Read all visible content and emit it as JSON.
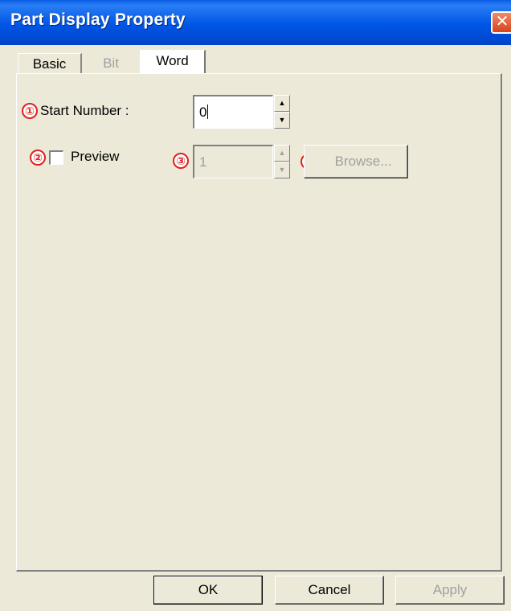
{
  "window": {
    "title": "Part Display Property",
    "close_icon": "close-icon"
  },
  "tabs": [
    {
      "label": "Basic",
      "state": "inactive"
    },
    {
      "label": "Bit",
      "state": "disabled"
    },
    {
      "label": "Word",
      "state": "active"
    }
  ],
  "start_number": {
    "marker": "①",
    "label": "Start Number :",
    "value": "0",
    "spin_up_icon": "spin-up-icon",
    "spin_down_icon": "spin-down-icon"
  },
  "preview": {
    "marker": "②",
    "label": "Preview",
    "checked": false
  },
  "preview_value": {
    "marker": "③",
    "value": "1",
    "enabled": false
  },
  "browse": {
    "marker": "④",
    "label": "Browse...",
    "enabled": false
  },
  "footer": {
    "ok_label": "OK",
    "cancel_label": "Cancel",
    "apply_label": "Apply"
  },
  "colors": {
    "titlebar": "#0055e5",
    "dialog_bg": "#ece9d8",
    "marker": "#e02020"
  }
}
